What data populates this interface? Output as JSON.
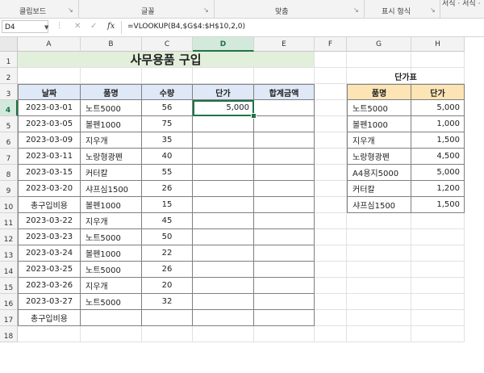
{
  "ribbon": {
    "groups": [
      "클립보드",
      "글꼴",
      "맞춤",
      "표시 형식"
    ],
    "top_right": "서식 · 서식 ·"
  },
  "formula_bar": {
    "name_box": "D4",
    "fx": "fx",
    "formula": "=VLOOKUP(B4,$G$4:$H$10,2,0)"
  },
  "columns": [
    "A",
    "B",
    "C",
    "D",
    "E",
    "F",
    "G",
    "H"
  ],
  "rows": [
    "1",
    "2",
    "3",
    "4",
    "5",
    "6",
    "7",
    "8",
    "9",
    "10",
    "11",
    "12",
    "13",
    "14",
    "15",
    "16",
    "17",
    "18"
  ],
  "title": "사무용품 구입",
  "table": {
    "headers": [
      "날짜",
      "품명",
      "수량",
      "단가",
      "합계금액"
    ],
    "rows": [
      [
        "2023-03-01",
        "노트5000",
        "56",
        "5,000",
        ""
      ],
      [
        "2023-03-05",
        "볼펜1000",
        "75",
        "",
        ""
      ],
      [
        "2023-03-09",
        "지우개",
        "35",
        "",
        ""
      ],
      [
        "2023-03-11",
        "노랑형광펜",
        "40",
        "",
        ""
      ],
      [
        "2023-03-15",
        "커터칼",
        "55",
        "",
        ""
      ],
      [
        "2023-03-20",
        "샤프심1500",
        "26",
        "",
        ""
      ],
      [
        "총구입비용",
        "볼펜1000",
        "15",
        "",
        ""
      ],
      [
        "2023-03-22",
        "지우개",
        "45",
        "",
        ""
      ],
      [
        "2023-03-23",
        "노트5000",
        "50",
        "",
        ""
      ],
      [
        "2023-03-24",
        "볼펜1000",
        "22",
        "",
        ""
      ],
      [
        "2023-03-25",
        "노트5000",
        "26",
        "",
        ""
      ],
      [
        "2023-03-26",
        "지우개",
        "20",
        "",
        ""
      ],
      [
        "2023-03-27",
        "노트5000",
        "32",
        "",
        ""
      ],
      [
        "총구입비용",
        "",
        "",
        "",
        ""
      ]
    ]
  },
  "price_table": {
    "title": "단가표",
    "headers": [
      "품명",
      "단가"
    ],
    "rows": [
      [
        "노트5000",
        "5,000"
      ],
      [
        "볼펜1000",
        "1,000"
      ],
      [
        "지우개",
        "1,500"
      ],
      [
        "노랑형광펜",
        "4,500"
      ],
      [
        "A4용지5000",
        "5,000"
      ],
      [
        "커터칼",
        "1,200"
      ],
      [
        "샤프심1500",
        "1,500"
      ]
    ]
  },
  "colors": {
    "accent": "#217346",
    "title_fill": "#e2efda",
    "header_fill": "#dfe8f6",
    "price_header_fill": "#fce4b5"
  }
}
